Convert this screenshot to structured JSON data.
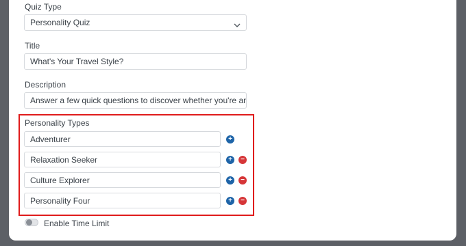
{
  "quiz_type": {
    "label": "Quiz Type",
    "value": "Personality Quiz"
  },
  "title": {
    "label": "Title",
    "value": "What's Your Travel Style?"
  },
  "description": {
    "label": "Description",
    "value": "Answer a few quick questions to discover whether you're an Adven"
  },
  "personality_types": {
    "label": "Personality Types",
    "items": [
      "Adventurer",
      "Relaxation Seeker",
      "Culture Explorer",
      "Personality Four"
    ]
  },
  "time_limit": {
    "label": "Enable Time Limit",
    "enabled": false
  },
  "icons": {
    "add": "plus-circle-icon",
    "remove": "minus-circle-icon",
    "dropdown": "chevron-down-icon"
  },
  "colors": {
    "add": "#1e64a8",
    "remove": "#d63638",
    "highlight": "#e01b1b"
  }
}
